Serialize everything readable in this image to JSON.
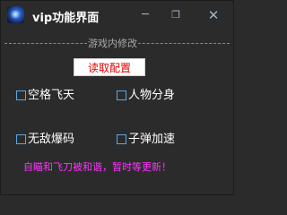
{
  "window": {
    "title": "vip功能界面",
    "icon": "app-logo-icon",
    "controls": {
      "minimize": "─",
      "maximize": "❐",
      "close": "✕"
    }
  },
  "group": {
    "label": "游戏内修改"
  },
  "buttons": {
    "read_config": "读取配置"
  },
  "options": [
    {
      "label": "空格飞天",
      "checked": false
    },
    {
      "label": "人物分身",
      "checked": false
    },
    {
      "label": "无敌爆码",
      "checked": false
    },
    {
      "label": "子弹加速",
      "checked": false
    }
  ],
  "notice": "自瞄和飞刀被和谐，暂时等更新！",
  "colors": {
    "background": "#2b2b2b",
    "notice": "#ff33ff",
    "button_text": "#e00000",
    "checkbox_border": "#5aa8e6"
  }
}
